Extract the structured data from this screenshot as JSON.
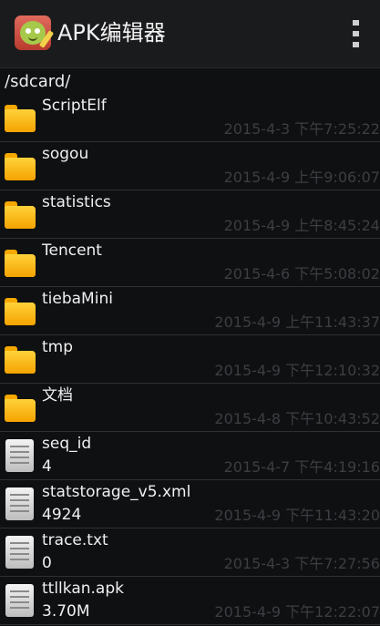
{
  "app": {
    "title": "APK编辑器",
    "icon": "apk-editor-app-icon",
    "menu_icon": "overflow-menu-icon"
  },
  "path": "/sdcard/",
  "files": [
    {
      "name": "ScriptElf",
      "type": "folder",
      "size": "",
      "date": "2015-4-3 下午7:25:22"
    },
    {
      "name": "sogou",
      "type": "folder",
      "size": "",
      "date": "2015-4-9 上午9:06:07"
    },
    {
      "name": "statistics",
      "type": "folder",
      "size": "",
      "date": "2015-4-9 上午8:45:24"
    },
    {
      "name": "Tencent",
      "type": "folder",
      "size": "",
      "date": "2015-4-6 下午5:08:02"
    },
    {
      "name": "tiebaMini",
      "type": "folder",
      "size": "",
      "date": "2015-4-9 上午11:43:37"
    },
    {
      "name": "tmp",
      "type": "folder",
      "size": "",
      "date": "2015-4-9 下午12:10:32"
    },
    {
      "name": "文档",
      "type": "folder",
      "size": "",
      "date": "2015-4-8 下午10:43:52"
    },
    {
      "name": "seq_id",
      "type": "file",
      "size": "4",
      "date": "2015-4-7 下午4:19:16"
    },
    {
      "name": "statstorage_v5.xml",
      "type": "file",
      "size": "4924",
      "date": "2015-4-9 下午11:43:20"
    },
    {
      "name": "trace.txt",
      "type": "file",
      "size": "0",
      "date": "2015-4-3 下午7:27:56"
    },
    {
      "name": "ttllkan.apk",
      "type": "file",
      "size": "3.70M",
      "date": "2015-4-9 下午12:22:07"
    }
  ]
}
